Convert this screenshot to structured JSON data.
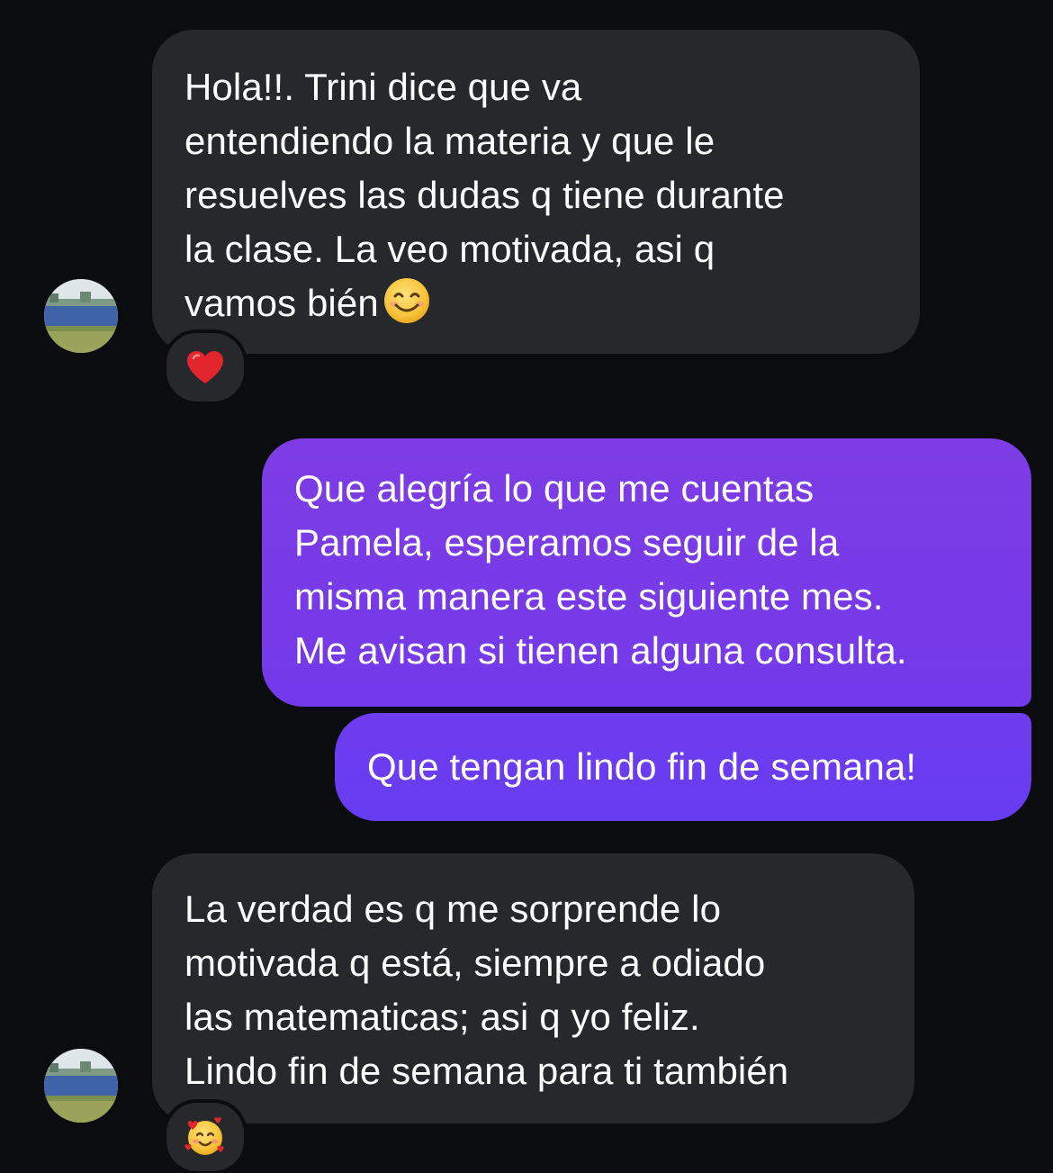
{
  "messages": [
    {
      "direction": "incoming",
      "lines": [
        "Hola!!. Trini dice que va",
        "entendiendo la materia y que le",
        "resuelves las dudas q tiene durante",
        "la clase. La veo motivada, asi q",
        "vamos bién"
      ],
      "trailing_emoji": "smiling-face-icon",
      "reaction": "red-heart-icon"
    },
    {
      "direction": "outgoing",
      "lines": [
        "Que alegría lo que me cuentas",
        "Pamela, esperamos seguir de la",
        "misma manera este siguiente mes.",
        "Me avisan si tienen alguna consulta."
      ]
    },
    {
      "direction": "outgoing",
      "lines": [
        "Que tengan lindo fin de semana!"
      ]
    },
    {
      "direction": "incoming",
      "lines": [
        "La verdad es q me sorprende lo",
        "motivada q está, siempre a odiado",
        "las matematicas; asi q yo feliz.",
        "Lindo fin de semana para ti también"
      ],
      "reaction": "smiling-face-with-hearts-icon"
    }
  ],
  "colors": {
    "background": "#0b0c10",
    "incoming_bubble": "#26282c",
    "outgoing_bubble_top": "#7c3ce6",
    "outgoing_bubble_bottom": "#6d3cf0",
    "text": "#ffffff"
  }
}
